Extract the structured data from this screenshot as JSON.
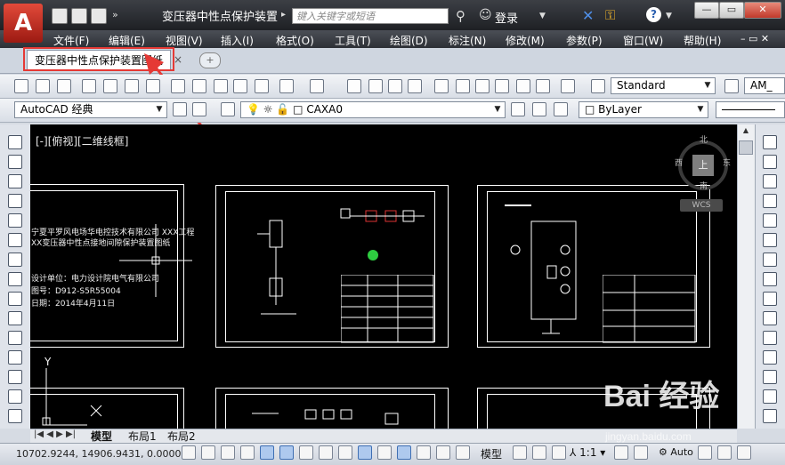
{
  "titlebar": {
    "doc_title": "变压器中性点保护装置...",
    "search_placeholder": "键入关键字或短语",
    "login_label": "登录",
    "help_label": "?"
  },
  "window_controls": {
    "minimize": "—",
    "restore": "▭",
    "close": "✕"
  },
  "menu": {
    "items": [
      "文件(F)",
      "编辑(E)",
      "视图(V)",
      "插入(I)",
      "格式(O)",
      "工具(T)",
      "绘图(D)",
      "标注(N)",
      "修改(M)",
      "参数(P)",
      "窗口(W)",
      "帮助(H)"
    ]
  },
  "tabs": {
    "active_label": "变压器中性点保护装置图纸",
    "close_glyph": "×",
    "new_tab_glyph": "+"
  },
  "toolbar": {
    "text_style": "Standard",
    "dim_style": "AM_",
    "workspace": "AutoCAD 经典",
    "layer": "CAXA0",
    "color": "ByLayer"
  },
  "canvas": {
    "viewport_label": "[-][俯视][二维线框]",
    "compass": {
      "north": "北",
      "south": "南",
      "east": "东",
      "west": "西",
      "center": "上",
      "ucs": "WCS"
    },
    "ucs_y": "Y",
    "drawing1_lines": [
      "宁夏平罗风电场华电控技术有限公司 XXX工程",
      "XX变压器中性点接地间隙保护装置图纸",
      "设计单位：电力设计院电气有限公司",
      "图号：D912-S5R55004",
      "日期：2014年4月11日"
    ]
  },
  "layout_tabs": [
    "模型",
    "布局1",
    "布局2"
  ],
  "status": {
    "coords": "10702.9244, 14906.9431, 0.0000",
    "model_label": "模型",
    "scale": "1:1",
    "annotation": "Auto"
  },
  "watermark": {
    "main": "Bai 经验",
    "sub": "jingyan.baidu.com"
  },
  "colors": {
    "accent": "#e53935",
    "titlebar": "#2a2c31",
    "canvas": "#000000"
  }
}
